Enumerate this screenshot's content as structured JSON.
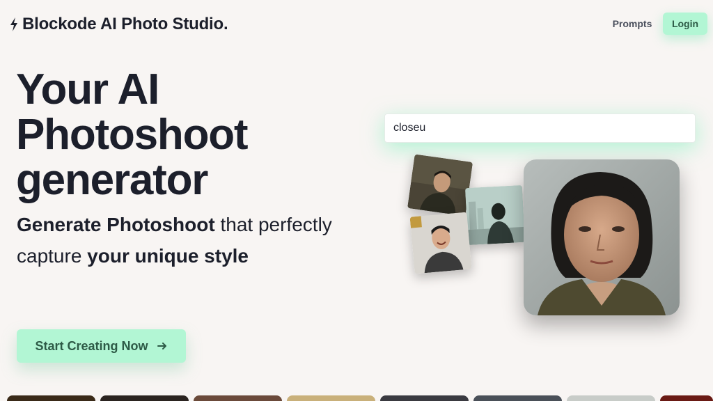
{
  "header": {
    "brand": "Blockode AI Photo Studio.",
    "nav_prompts": "Prompts",
    "nav_login": "Login"
  },
  "hero": {
    "title_line1": "Your AI",
    "title_line2": "Photoshoot",
    "title_line3": "generator",
    "sub_bold1": "Generate Photoshoot",
    "sub_text1": " that perfectly capture ",
    "sub_bold2": "your unique style",
    "cta_label": "Start Creating Now"
  },
  "prompt": {
    "value": "closeu"
  },
  "colors": {
    "accent": "#b2f6d4",
    "accent_text": "#2d5a46",
    "background": "#f8f5f3",
    "text": "#1c1f2b"
  },
  "strip_colors": [
    "#3a2a18",
    "#2b2420",
    "#6b4a3a",
    "#c9b07a",
    "#3a3a40",
    "#4a5058",
    "#c8ccc8",
    "#6a1a14"
  ]
}
